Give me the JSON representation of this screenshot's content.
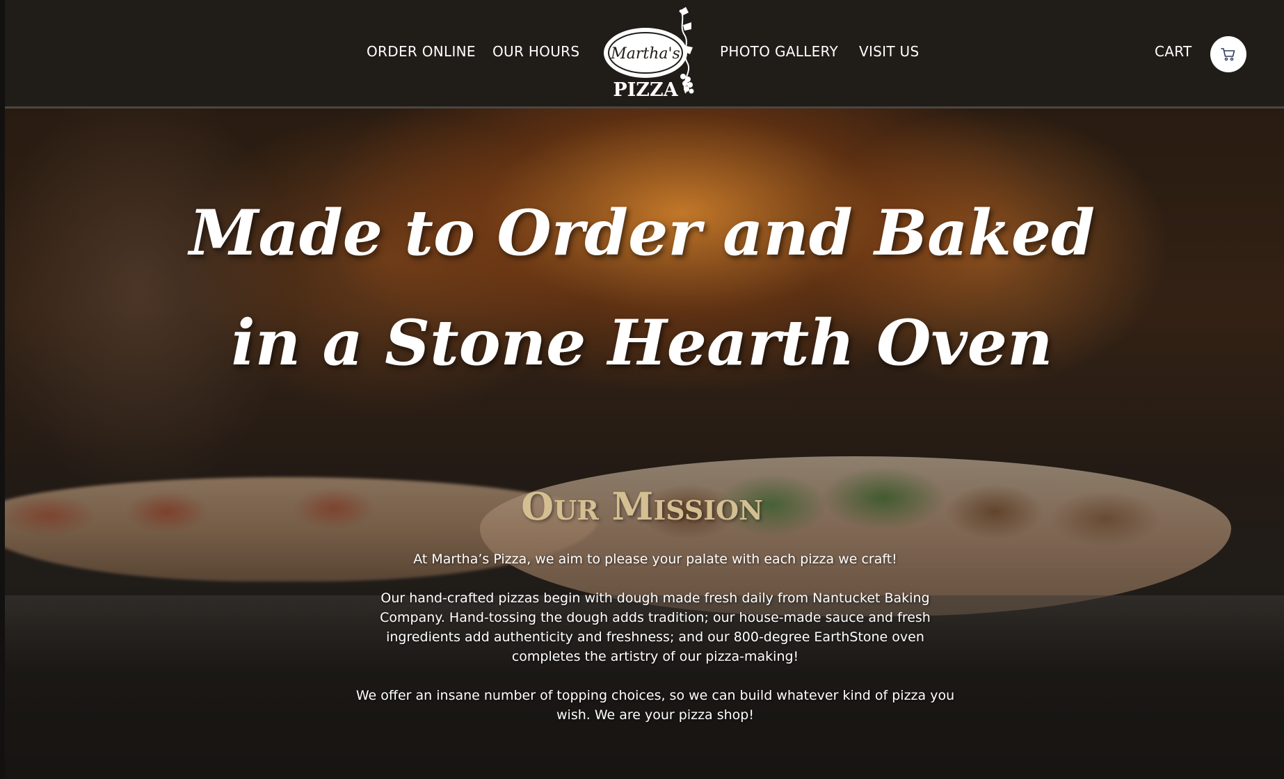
{
  "nav": {
    "order_online": "ORDER ONLINE",
    "our_hours": "OUR HOURS",
    "photo_gallery": "PHOTO GALLERY",
    "visit_us": "VISIT US",
    "cart": "CART"
  },
  "logo": {
    "script": "Martha's",
    "word": "PIZZA"
  },
  "icons": {
    "cart": "cart-icon"
  },
  "hero": {
    "title_line1": "Made to Order and Baked",
    "title_line2": "in a Stone Hearth Oven"
  },
  "mission": {
    "title": "Our Mission",
    "p1": "At Martha’s Pizza, we aim to please your palate with each pizza we craft!",
    "p2": "Our hand-crafted pizzas begin with dough made fresh daily from Nantucket Baking Company. Hand-tossing the dough adds tradition; our house-made sauce and fresh ingredients add authenticity and freshness; and our 800-degree EarthStone oven completes the artistry of our pizza-making!",
    "p3": "We offer an insane number of topping choices, so we can build whatever kind of pizza you wish. We are your pizza shop!"
  },
  "colors": {
    "header_bg": "#201c18",
    "mission_title": "#d4bf92",
    "text": "#ffffff"
  }
}
